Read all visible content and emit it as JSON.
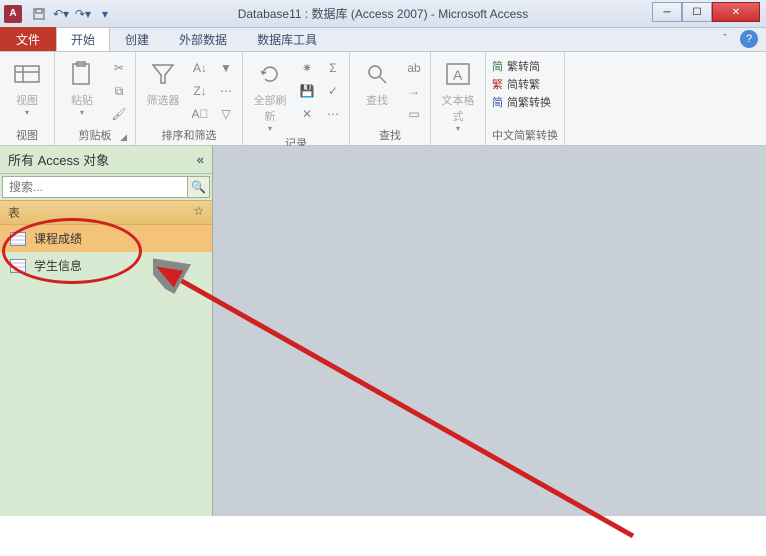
{
  "title": "Database11 : 数据库 (Access 2007)  -  Microsoft Access",
  "app_letter": "A",
  "tabs": {
    "file": "文件",
    "home": "开始",
    "create": "创建",
    "external": "外部数据",
    "dbtools": "数据库工具"
  },
  "ribbon": {
    "view": {
      "label": "视图",
      "group": "视图"
    },
    "clipboard": {
      "paste": "粘贴",
      "group": "剪贴板"
    },
    "sortfilter": {
      "filter": "筛选器",
      "group": "排序和筛选"
    },
    "records": {
      "refresh": "全部刷新",
      "group": "记录"
    },
    "find": {
      "find": "查找",
      "group": "查找"
    },
    "textfmt": {
      "label": "文本格式",
      "group": ""
    },
    "chs": {
      "simp": "繁转简",
      "trad": "简转繁",
      "conv": "简繁转换",
      "group": "中文简繁转换"
    }
  },
  "nav": {
    "title": "所有 Access 对象",
    "search_placeholder": "搜索...",
    "group_tables": "表",
    "items": [
      {
        "label": "课程成绩"
      },
      {
        "label": "学生信息"
      }
    ]
  },
  "chs_prefix": {
    "simp": "简",
    "trad": "繁",
    "conv": "简"
  }
}
